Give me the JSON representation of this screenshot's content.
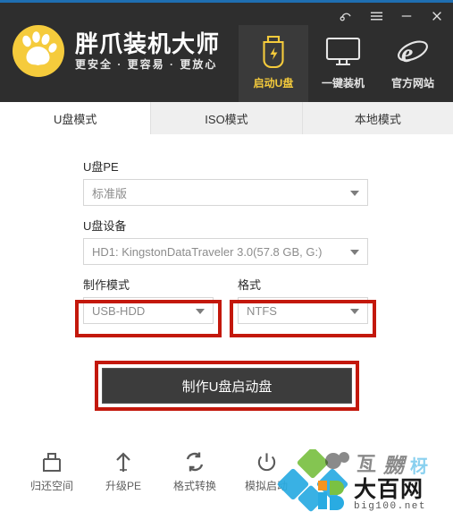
{
  "window": {
    "accent_color": "#1f6fb2",
    "header_bg": "#2e2e2e",
    "controls": [
      {
        "name": "support-headset",
        "label": ""
      },
      {
        "name": "menu",
        "label": ""
      },
      {
        "name": "minimize",
        "label": ""
      },
      {
        "name": "close",
        "label": ""
      }
    ]
  },
  "brand": {
    "logo_icon": "paw-icon",
    "logo_color": "#f5cb3c",
    "title": "胖爪装机大师",
    "subtitle": "更安全  ·  更容易  ·  更放心"
  },
  "nav": {
    "active_color": "#f5cb3c",
    "items": [
      {
        "label": "启动U盘",
        "icon": "usb-drive-icon",
        "active": true
      },
      {
        "label": "一键装机",
        "icon": "monitor-icon",
        "active": false
      },
      {
        "label": "官方网站",
        "icon": "internet-explorer-icon",
        "active": false
      }
    ]
  },
  "tabs": {
    "items": [
      {
        "label": "U盘模式",
        "active": true
      },
      {
        "label": "ISO模式",
        "active": false
      },
      {
        "label": "本地模式",
        "active": false
      }
    ]
  },
  "form": {
    "pe": {
      "label": "U盘PE",
      "value": "标准版"
    },
    "device": {
      "label": "U盘设备",
      "value": "HD1: KingstonDataTraveler 3.0(57.8 GB, G:)"
    },
    "mode": {
      "label": "制作模式",
      "value": "USB-HDD"
    },
    "format": {
      "label": "格式",
      "value": "NTFS"
    }
  },
  "action": {
    "make_button": "制作U盘启动盘"
  },
  "highlight": {
    "color": "#c3180c"
  },
  "toolbar": {
    "items": [
      {
        "label": "归还空间",
        "icon": "restore-space-icon"
      },
      {
        "label": "升级PE",
        "icon": "upgrade-arrow-icon"
      },
      {
        "label": "格式转换",
        "icon": "format-convert-icon"
      },
      {
        "label": "模拟启动",
        "icon": "power-simulate-icon"
      }
    ]
  },
  "watermark": {
    "cn": "大百网",
    "en": "big100.net"
  }
}
